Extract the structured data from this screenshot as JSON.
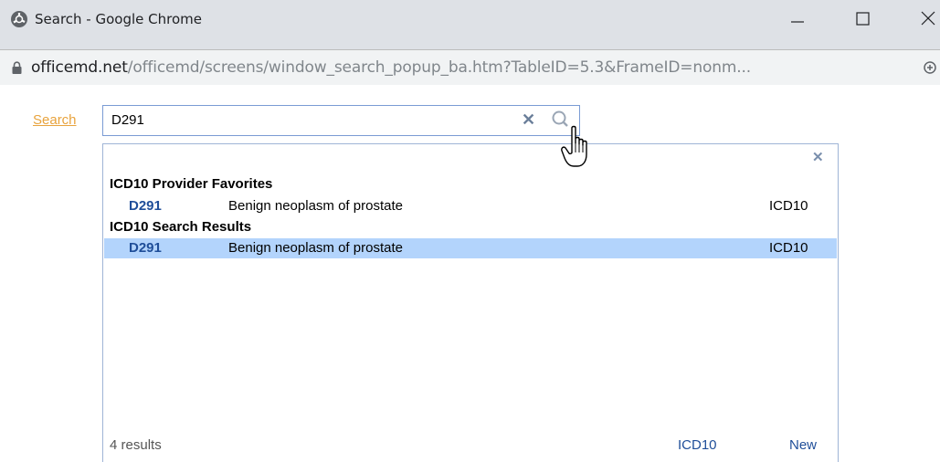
{
  "window": {
    "title": "Search - Google Chrome",
    "min_icon": "minimize-icon",
    "max_icon": "maximize-icon",
    "close_icon": "close-icon"
  },
  "address": {
    "host": "officemd.net",
    "path": "/officemd/screens/window_search_popup_ba.htm?TableID=5.3&FrameID=nonm..."
  },
  "search": {
    "link_label": "Search",
    "value": "D291"
  },
  "popup": {
    "groups": [
      {
        "header": "ICD10 Provider Favorites",
        "rows": [
          {
            "code": "D291",
            "description": "Benign neoplasm of prostate",
            "type": "ICD10",
            "selected": false
          }
        ]
      },
      {
        "header": "ICD10 Search Results",
        "rows": [
          {
            "code": "D291",
            "description": "Benign neoplasm of prostate",
            "type": "ICD10",
            "selected": true
          }
        ]
      }
    ],
    "footer": {
      "count": "4 results",
      "code_link": "ICD10",
      "new_link": "New"
    }
  },
  "colors": {
    "link_orange": "#e8a33d",
    "code_blue": "#1f4e99",
    "selection": "#b3d4fc"
  }
}
